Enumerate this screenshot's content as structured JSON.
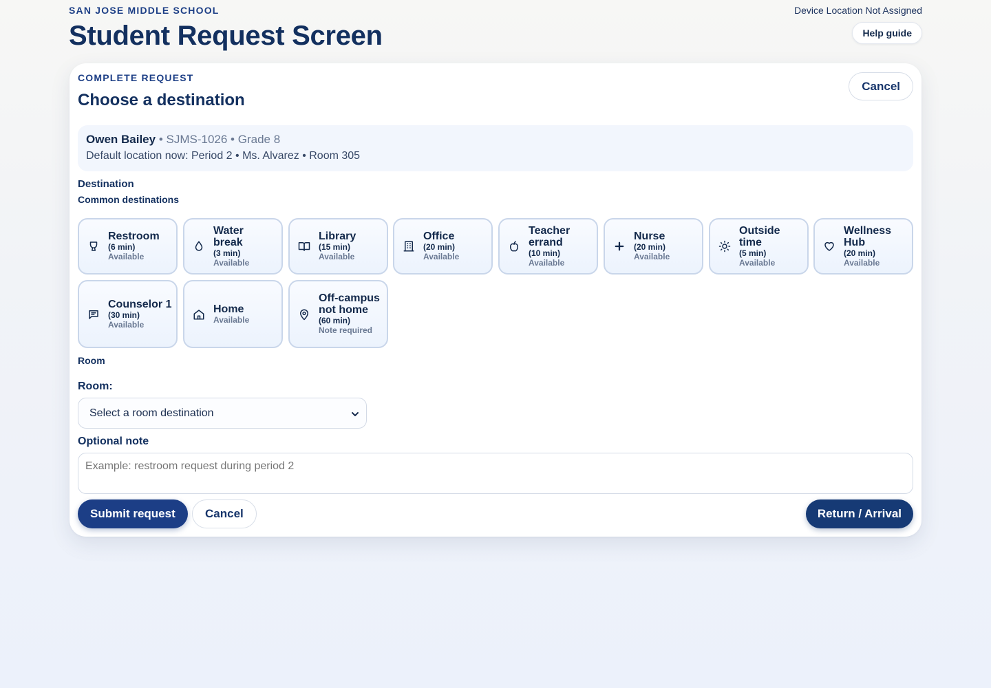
{
  "header": {
    "school": "SAN JOSE MIDDLE SCHOOL",
    "title": "Student Request Screen",
    "device_location": "Device Location Not Assigned",
    "help_label": "Help guide"
  },
  "card": {
    "eyebrow": "COMPLETE REQUEST",
    "title": "Choose a destination",
    "cancel_label": "Cancel"
  },
  "student": {
    "name": "Owen Bailey",
    "meta": " • SJMS-1026 • Grade 8",
    "default_location": "Default location now: Period 2 • Ms. Alvarez • Room 305"
  },
  "destinations": {
    "section_label": "Destination",
    "common_label": "Common destinations",
    "items": [
      {
        "name": "Restroom",
        "duration": "(6 min)",
        "status": "Available",
        "icon": "restroom-icon"
      },
      {
        "name": "Water break",
        "duration": "(3 min)",
        "status": "Available",
        "icon": "water-drop-icon"
      },
      {
        "name": "Library",
        "duration": "(15 min)",
        "status": "Available",
        "icon": "book-icon"
      },
      {
        "name": "Office",
        "duration": "(20 min)",
        "status": "Available",
        "icon": "building-icon"
      },
      {
        "name": "Teacher errand",
        "duration": "(10 min)",
        "status": "Available",
        "icon": "apple-icon"
      },
      {
        "name": "Nurse",
        "duration": "(20 min)",
        "status": "Available",
        "icon": "medical-cross-icon"
      },
      {
        "name": "Outside time",
        "duration": "(5 min)",
        "status": "Available",
        "icon": "sun-icon"
      },
      {
        "name": "Wellness Hub",
        "duration": "(20 min)",
        "status": "Available",
        "icon": "heart-icon"
      },
      {
        "name": "Counselor 1",
        "duration": "(30 min)",
        "status": "Available",
        "icon": "chat-icon"
      },
      {
        "name": "Home",
        "duration": "",
        "status": "Available",
        "icon": "home-icon"
      },
      {
        "name": "Off-campus not home",
        "duration": "(60 min)",
        "status": "Note required",
        "icon": "map-pin-icon"
      }
    ]
  },
  "room": {
    "section_label": "Room",
    "field_label": "Room:",
    "selected": "Select a room destination"
  },
  "note": {
    "label": "Optional note",
    "placeholder": "Example: restroom request during period 2"
  },
  "actions": {
    "submit_label": "Submit request",
    "cancel_label": "Cancel",
    "return_label": "Return / Arrival"
  },
  "colors": {
    "primary": "#1c3e86",
    "primary_dark": "#163a75",
    "heading": "#13305f",
    "muted": "#6a7993",
    "tile_border": "#c9d6ea"
  }
}
